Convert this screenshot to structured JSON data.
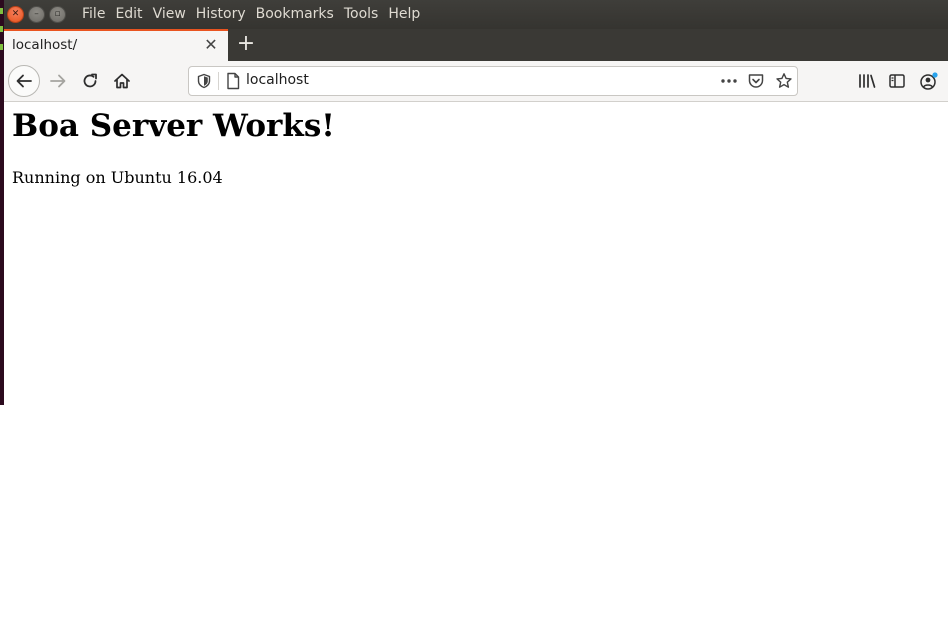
{
  "menubar": {
    "items": [
      "File",
      "Edit",
      "View",
      "History",
      "Bookmarks",
      "Tools",
      "Help"
    ]
  },
  "tabs": [
    {
      "title": "localhost/",
      "active": true
    }
  ],
  "toolbar": {
    "url": "localhost"
  },
  "page": {
    "heading": "Boa Server Works!",
    "text": "Running on Ubuntu 16.04"
  },
  "colors": {
    "accent": "#e95420",
    "menubar_bg": "#3c3b37",
    "toolbar_bg": "#f6f5f4"
  },
  "icons": {
    "window_close": "close-icon",
    "window_minimize": "minimize-icon",
    "window_maximize": "maximize-icon",
    "back": "arrow-left-icon",
    "forward": "arrow-right-icon",
    "reload": "reload-icon",
    "home": "home-icon",
    "tracking_protection": "shield-icon",
    "page": "page-icon",
    "page_actions": "more-icon",
    "pocket": "pocket-icon",
    "bookmark": "star-icon",
    "library": "library-icon",
    "sidebar": "sidebar-icon",
    "account": "account-icon"
  }
}
